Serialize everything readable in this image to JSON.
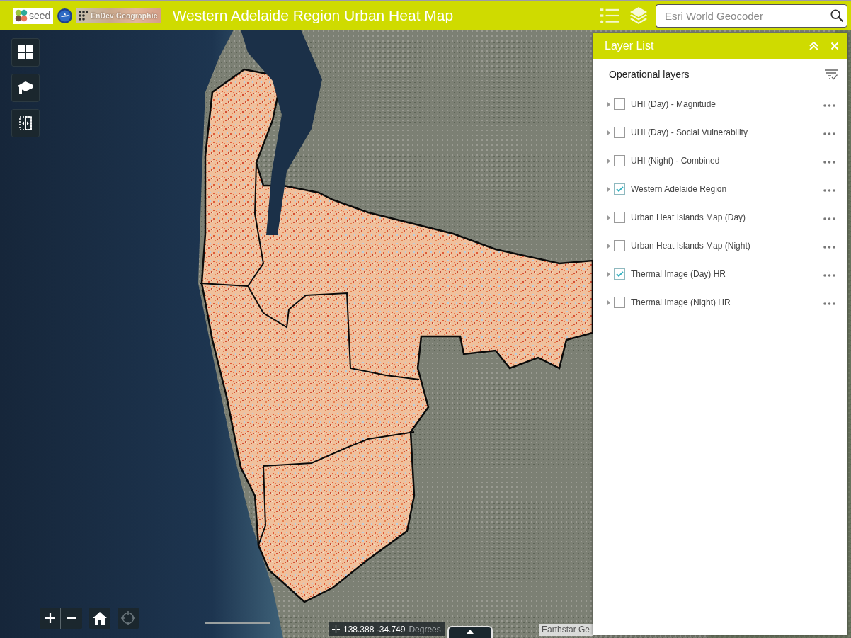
{
  "header": {
    "logos": [
      {
        "kind": "seed",
        "text": "seed"
      },
      {
        "kind": "globe"
      },
      {
        "kind": "endev",
        "text": "EnDev Geographic"
      }
    ],
    "title": "Western Adelaide Region Urban Heat Map"
  },
  "search": {
    "placeholder": "Esri World Geocoder"
  },
  "layer_list": {
    "title": "Layer List",
    "section": "Operational layers",
    "layers": [
      {
        "label": "UHI (Day) - Magnitude",
        "checked": false
      },
      {
        "label": "UHI (Day) - Social Vulnerability",
        "checked": false
      },
      {
        "label": "UHI (Night) - Combined",
        "checked": false
      },
      {
        "label": "Western Adelaide Region",
        "checked": true
      },
      {
        "label": "Urban Heat Islands Map (Day)",
        "checked": false
      },
      {
        "label": "Urban Heat Islands Map (Night)",
        "checked": false
      },
      {
        "label": "Thermal Image (Day) HR",
        "checked": true
      },
      {
        "label": "Thermal Image (Night) HR",
        "checked": false
      }
    ]
  },
  "coordinates": {
    "value": "138.388 -34.749",
    "unit": "Degrees"
  },
  "attribution": "Earthstar Ge"
}
